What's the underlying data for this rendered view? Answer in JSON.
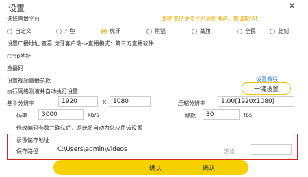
{
  "dialog": {
    "title": "设置",
    "hint": "即将支持更多平台同时推送，敬请期待!"
  },
  "platform": {
    "label": "选择直播平台",
    "options": [
      "自定义",
      "斗鱼",
      "虎牙",
      "熊猫",
      "战旗",
      "全民",
      "此刻"
    ],
    "selected": "虎牙"
  },
  "address_note": "设置广播地址  查看 虎牙客户端->直播模式：第三方直播软件",
  "rtmp_label": "rtmp地址",
  "code_label": "直播码",
  "video_section": {
    "label": "设置视频直播参数",
    "tutorial_link": "设置教程"
  },
  "network_test": {
    "label": "执行网络测速并自动执行设置",
    "button": "一键设置"
  },
  "resolution": {
    "label": "基本分辨率",
    "width": "1920",
    "sep": "x",
    "height": "1080",
    "scaled_label": "压缩分辨率",
    "scaled_value": "1.00(1920x1080)"
  },
  "bitrate": {
    "label": "码率",
    "value": "3000",
    "unit": "kb/s",
    "fps_label": "帧数",
    "fps_value": "30",
    "fps_unit": "fps"
  },
  "confirm_note": "修改编码参数并确认后，系统将自动为您应用该设置",
  "recording": {
    "label": "录像储存地址",
    "path_label": "保存路径",
    "path_value": "C:\\Users\\admin\\Videos",
    "browse": "浏览"
  },
  "footer": {
    "confirm": "确认",
    "confirm2": "确认"
  }
}
